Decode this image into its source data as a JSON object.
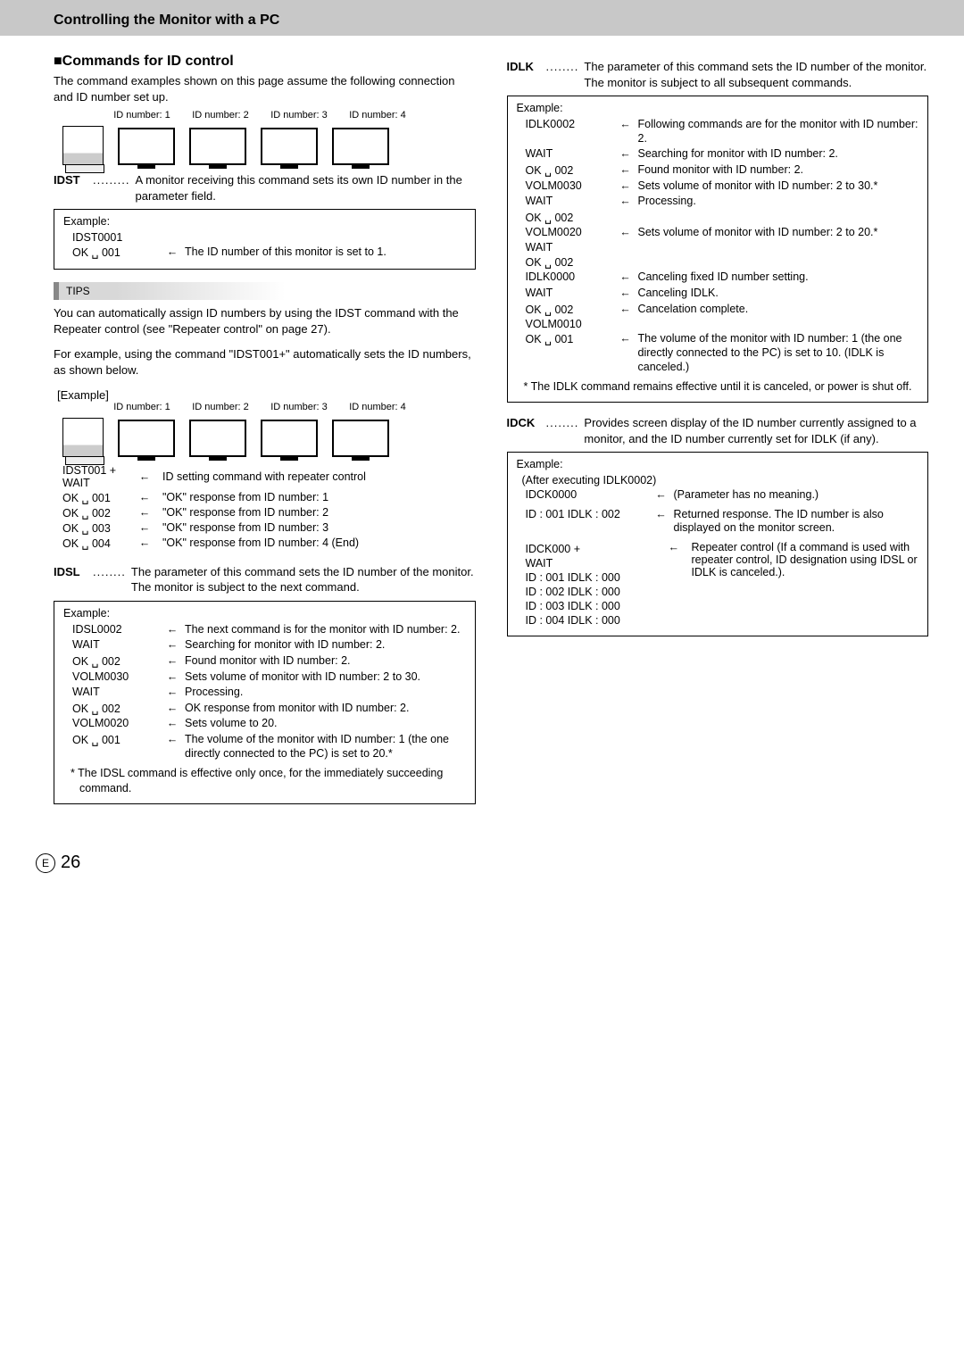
{
  "header": "Controlling the Monitor with a PC",
  "section_title_prefix": "■",
  "section_title": "Commands for ID control",
  "intro": "The command examples shown on this page assume the following connection and ID number set up.",
  "diag_labels": [
    "ID number: 1",
    "ID number: 2",
    "ID number: 3",
    "ID number: 4"
  ],
  "idst_name": "IDST",
  "idst_desc": "A monitor receiving this command sets its own ID number in the parameter field.",
  "example_label": "Example:",
  "idst_box": {
    "l1": "IDST0001",
    "l2a": "OK ␣ 001",
    "l2b": "The ID number of this monitor is set to 1."
  },
  "tips_label": "TIPS",
  "tips_p1": "You can automatically assign ID numbers by using the IDST command with the Repeater control (see \"Repeater control\" on page 27).",
  "tips_p2": "For example, using the command \"IDST001+\" automatically sets the ID numbers, as shown below.",
  "example2_label": "[Example]",
  "idst_repeater": {
    "top1": "IDST001 +",
    "top2": "WAIT",
    "top_desc": "ID setting command with repeater control",
    "rows": [
      {
        "a": "OK ␣ 001",
        "b": "\"OK\" response from ID number: 1"
      },
      {
        "a": "OK ␣ 002",
        "b": "\"OK\" response from ID number: 2"
      },
      {
        "a": "OK ␣ 003",
        "b": "\"OK\" response from ID number: 3"
      },
      {
        "a": "OK ␣ 004",
        "b": "\"OK\" response from ID number: 4 (End)"
      }
    ]
  },
  "idsl_name": "IDSL",
  "idsl_desc": "The parameter of this command sets the ID number of the monitor. The monitor is subject to the next command.",
  "idsl_box": [
    {
      "a": "IDSL0002",
      "arr": "←",
      "b": "The next command is for the monitor with ID number: 2."
    },
    {
      "a": "WAIT",
      "arr": "←",
      "b": "Searching for monitor with ID number: 2."
    },
    {
      "a": "OK ␣ 002",
      "arr": "←",
      "b": "Found monitor with ID number: 2."
    },
    {
      "a": "VOLM0030",
      "arr": "←",
      "b": "Sets volume of monitor with ID number: 2 to 30."
    },
    {
      "a": "WAIT",
      "arr": "←",
      "b": "Processing."
    },
    {
      "a": "OK ␣ 002",
      "arr": "←",
      "b": "OK response from monitor with ID number: 2."
    },
    {
      "a": "VOLM0020",
      "arr": "←",
      "b": "Sets volume to 20."
    },
    {
      "a": "OK ␣ 001",
      "arr": "←",
      "b": "The volume of the monitor with ID number: 1 (the one directly connected to the PC) is set to 20.*"
    }
  ],
  "idsl_foot": "*  The IDSL command is effective only once, for the immediately succeeding command.",
  "idlk_name": "IDLK",
  "idlk_desc": "The parameter of this command sets the ID number of the monitor. The monitor is subject to all subsequent commands.",
  "idlk_box": [
    {
      "a": "IDLK0002",
      "arr": "←",
      "b": "Following commands are for the monitor with ID number: 2."
    },
    {
      "a": "WAIT",
      "arr": "←",
      "b": "Searching for monitor with ID number: 2."
    },
    {
      "a": "OK ␣ 002",
      "arr": "←",
      "b": "Found monitor with ID number: 2."
    },
    {
      "a": "VOLM0030",
      "arr": "←",
      "b": "Sets volume of monitor with ID number: 2 to 30.*"
    },
    {
      "a": "WAIT",
      "arr": "←",
      "b": "Processing."
    },
    {
      "a": "OK ␣ 002",
      "arr": "",
      "b": ""
    },
    {
      "a": "VOLM0020",
      "arr": "←",
      "b": "Sets volume of monitor with ID number: 2 to 20.*"
    },
    {
      "a": "WAIT",
      "arr": "",
      "b": ""
    },
    {
      "a": "OK ␣ 002",
      "arr": "",
      "b": ""
    },
    {
      "a": "IDLK0000",
      "arr": "←",
      "b": "Canceling fixed ID number setting."
    },
    {
      "a": "WAIT",
      "arr": "←",
      "b": "Canceling IDLK."
    },
    {
      "a": "OK ␣ 002",
      "arr": "←",
      "b": "Cancelation complete."
    },
    {
      "a": "VOLM0010",
      "arr": "",
      "b": ""
    },
    {
      "a": "OK ␣ 001",
      "arr": "←",
      "b": "The volume of the monitor with ID number: 1 (the one directly connected to the PC) is set to 10. (IDLK is canceled.)"
    }
  ],
  "idlk_foot": "*  The IDLK command remains effective until it is canceled, or power is shut off.",
  "idck_name": "IDCK",
  "idck_desc": "Provides screen display of the ID number currently assigned to a monitor, and the ID number currently set for IDLK (if any).",
  "idck_box": {
    "sub": "(After executing IDLK0002)",
    "r1a": "IDCK0000",
    "r1b": "(Parameter has no meaning.)",
    "r2a": "ID : 001    IDLK : 002",
    "r2b": "Returned response. The ID number is also displayed on the monitor screen.",
    "r3a_top": "IDCK000 +",
    "r3a_wait": "WAIT",
    "r3b": "Repeater control (If a command is used with repeater control, ID designation using IDSL or IDLK is canceled.).",
    "r4": [
      "ID : 001    IDLK : 000",
      "ID : 002    IDLK : 000",
      "ID : 003    IDLK : 000",
      "ID : 004    IDLK : 000"
    ]
  },
  "page_e": "E",
  "page_num": "26"
}
